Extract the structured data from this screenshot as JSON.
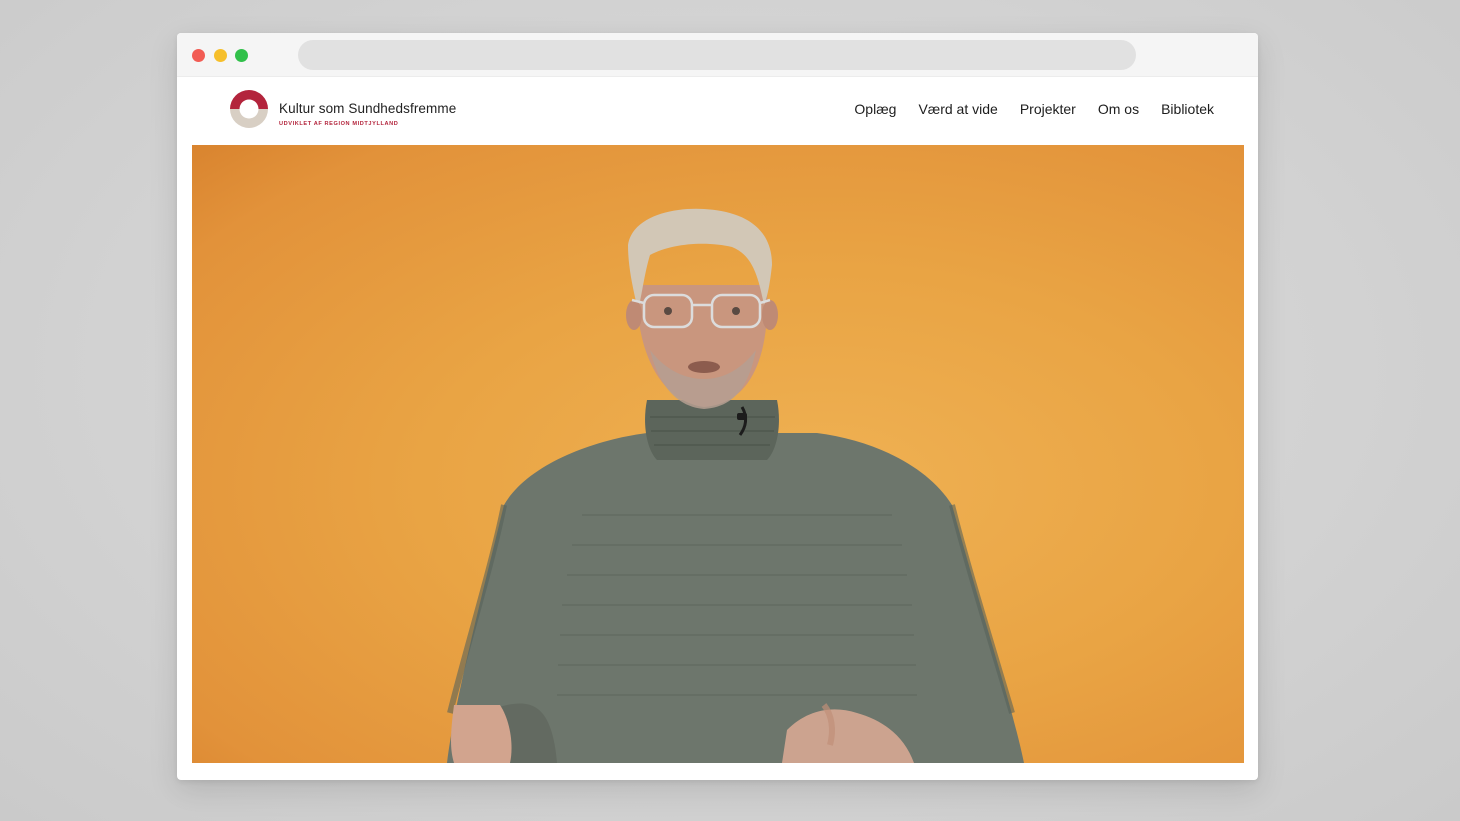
{
  "brand": {
    "title": "Kultur som Sundhedsfremme",
    "subtitle": "UDVIKLET AF REGION MIDTJYLLAND",
    "colors": {
      "primary": "#b3243c",
      "secondary": "#d8cfc4"
    }
  },
  "nav": {
    "items": [
      {
        "label": "Oplæg"
      },
      {
        "label": "Værd at vide"
      },
      {
        "label": "Projekter"
      },
      {
        "label": "Om os"
      },
      {
        "label": "Bibliotek"
      }
    ]
  },
  "hero": {
    "background_color": "#e9a444",
    "subject": "presenter-video-frame"
  },
  "window": {
    "controls": [
      "close-button",
      "minimize-button",
      "maximize-button"
    ],
    "colors": {
      "close": "#f25c54",
      "minimize": "#f6bf2b",
      "maximize": "#31c04a"
    }
  }
}
